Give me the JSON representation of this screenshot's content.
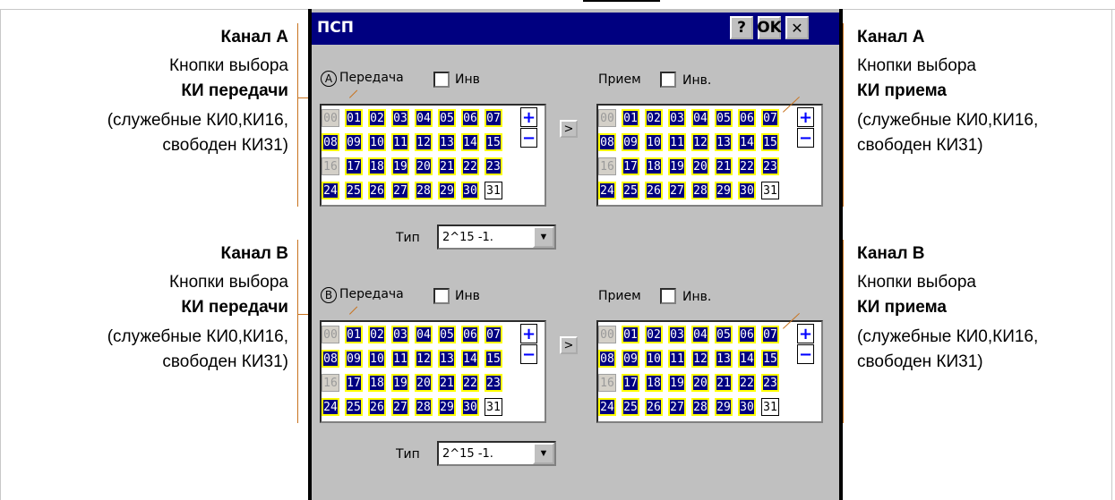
{
  "window": {
    "title": "ПСП",
    "help_label": "?",
    "ok_label": "OK",
    "close_label": "✕"
  },
  "channels": [
    {
      "radio": "A",
      "tx_label": "Передача",
      "tx_inv_label": "Инв",
      "rx_label": "Прием",
      "rx_inv_label": "Инв.",
      "copy_label": ">",
      "type_label": "Тип",
      "type_value": "2^15 -1.",
      "plus": "+",
      "minus": "−"
    },
    {
      "radio": "B",
      "tx_label": "Передача",
      "tx_inv_label": "Инв",
      "rx_label": "Прием",
      "rx_inv_label": "Инв.",
      "copy_label": ">",
      "type_label": "Тип",
      "type_value": "2^15 -1.",
      "plus": "+",
      "minus": "−"
    }
  ],
  "timeslots": [
    "00",
    "01",
    "02",
    "03",
    "04",
    "05",
    "06",
    "07",
    "08",
    "09",
    "10",
    "11",
    "12",
    "13",
    "14",
    "15",
    "16",
    "17",
    "18",
    "19",
    "20",
    "21",
    "22",
    "23",
    "24",
    "25",
    "26",
    "27",
    "28",
    "29",
    "30",
    "31"
  ],
  "service_timeslots": [
    "00",
    "16"
  ],
  "free_timeslots": [
    "31"
  ],
  "annotations": {
    "left_a": {
      "title": "Канал А",
      "line1": "Кнопки выбора",
      "bold": "КИ передачи",
      "note1": "(служебные КИ0,КИ16,",
      "note2": "свободен КИ31)"
    },
    "right_a": {
      "title": "Канал А",
      "line1": "Кнопки выбора",
      "bold": "КИ приема",
      "note1": "(служебные КИ0,КИ16,",
      "note2": "свободен КИ31)"
    },
    "left_b": {
      "title": "Канал В",
      "line1": "Кнопки выбора",
      "bold": "КИ передачи",
      "note1": "(служебные КИ0,КИ16,",
      "note2": "свободен КИ31)"
    },
    "right_b": {
      "title": "Канал В",
      "line1": "Кнопки выбора",
      "bold": "КИ приема",
      "note1": "(служебные КИ0,КИ16,",
      "note2": "свободен КИ31)"
    }
  },
  "colors": {
    "active_bg": "#000080",
    "active_border": "#ffff00",
    "leader_line": "#c8731e",
    "dialog_bg": "#c0c0c0"
  }
}
